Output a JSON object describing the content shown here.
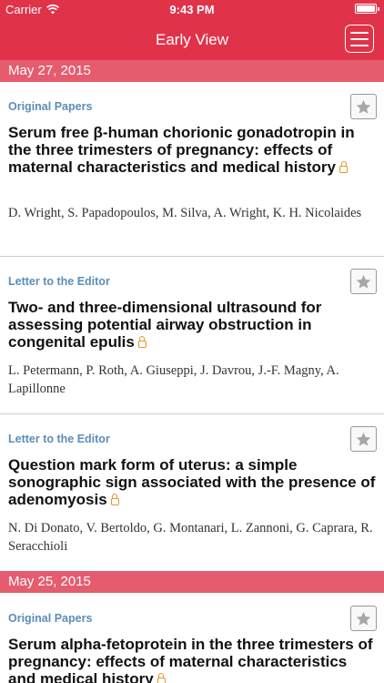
{
  "status": {
    "carrier": "Carrier",
    "time": "9:43 PM",
    "wifi_icon": "wifi-icon",
    "battery_level": 1.0
  },
  "nav": {
    "title": "Early View",
    "menu_icon": "hamburger-menu-icon"
  },
  "colors": {
    "header": "#e0334a",
    "section": "#e55c6e",
    "category": "#5c8db8",
    "lock": "#e8952b"
  },
  "sections": [
    {
      "date": "May 27, 2015",
      "articles": [
        {
          "category": "Original Papers",
          "title": "Serum free β-human chorionic gonadotropin in the three trimesters of pregnancy: effects of maternal characteristics and medical history",
          "authors": "D. Wright, S. Papadopoulos, M. Silva, A. Wright, K. H. Nicolaides",
          "open_access": true
        },
        {
          "category": "Letter to the Editor",
          "title": "Two- and three-dimensional ultrasound for assessing potential airway obstruction in congenital epulis",
          "authors": "L. Petermann, P. Roth, A. Giuseppi, J. Davrou, J.-F. Magny, A. Lapillonne",
          "open_access": true
        },
        {
          "category": "Letter to the Editor",
          "title": "Question mark form of uterus: a simple sonographic sign associated with the presence of adenomyosis",
          "authors": "N. Di Donato, V. Bertoldo, G. Montanari, L. Zannoni, G. Caprara, R. Seracchioli",
          "open_access": true
        }
      ]
    },
    {
      "date": "May 25, 2015",
      "articles": [
        {
          "category": "Original Papers",
          "title": "Serum alpha-fetoprotein in the three trimesters of pregnancy: effects of maternal characteristics and medical history",
          "authors": "",
          "open_access": true
        }
      ]
    }
  ]
}
